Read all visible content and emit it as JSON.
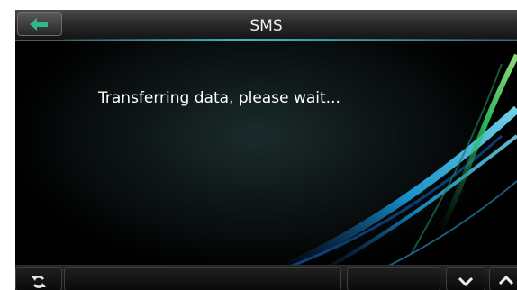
{
  "header": {
    "title": "SMS"
  },
  "main": {
    "message": "Transferring data, please wait..."
  },
  "icons": {
    "back": "back-arrow-icon",
    "refresh": "refresh-icon",
    "down": "chevron-down-icon",
    "up": "chevron-up-icon"
  },
  "colors": {
    "back_arrow": "#2fb98a",
    "accent": "#3fb8c4",
    "background": "#000000",
    "text": "#ffffff"
  }
}
